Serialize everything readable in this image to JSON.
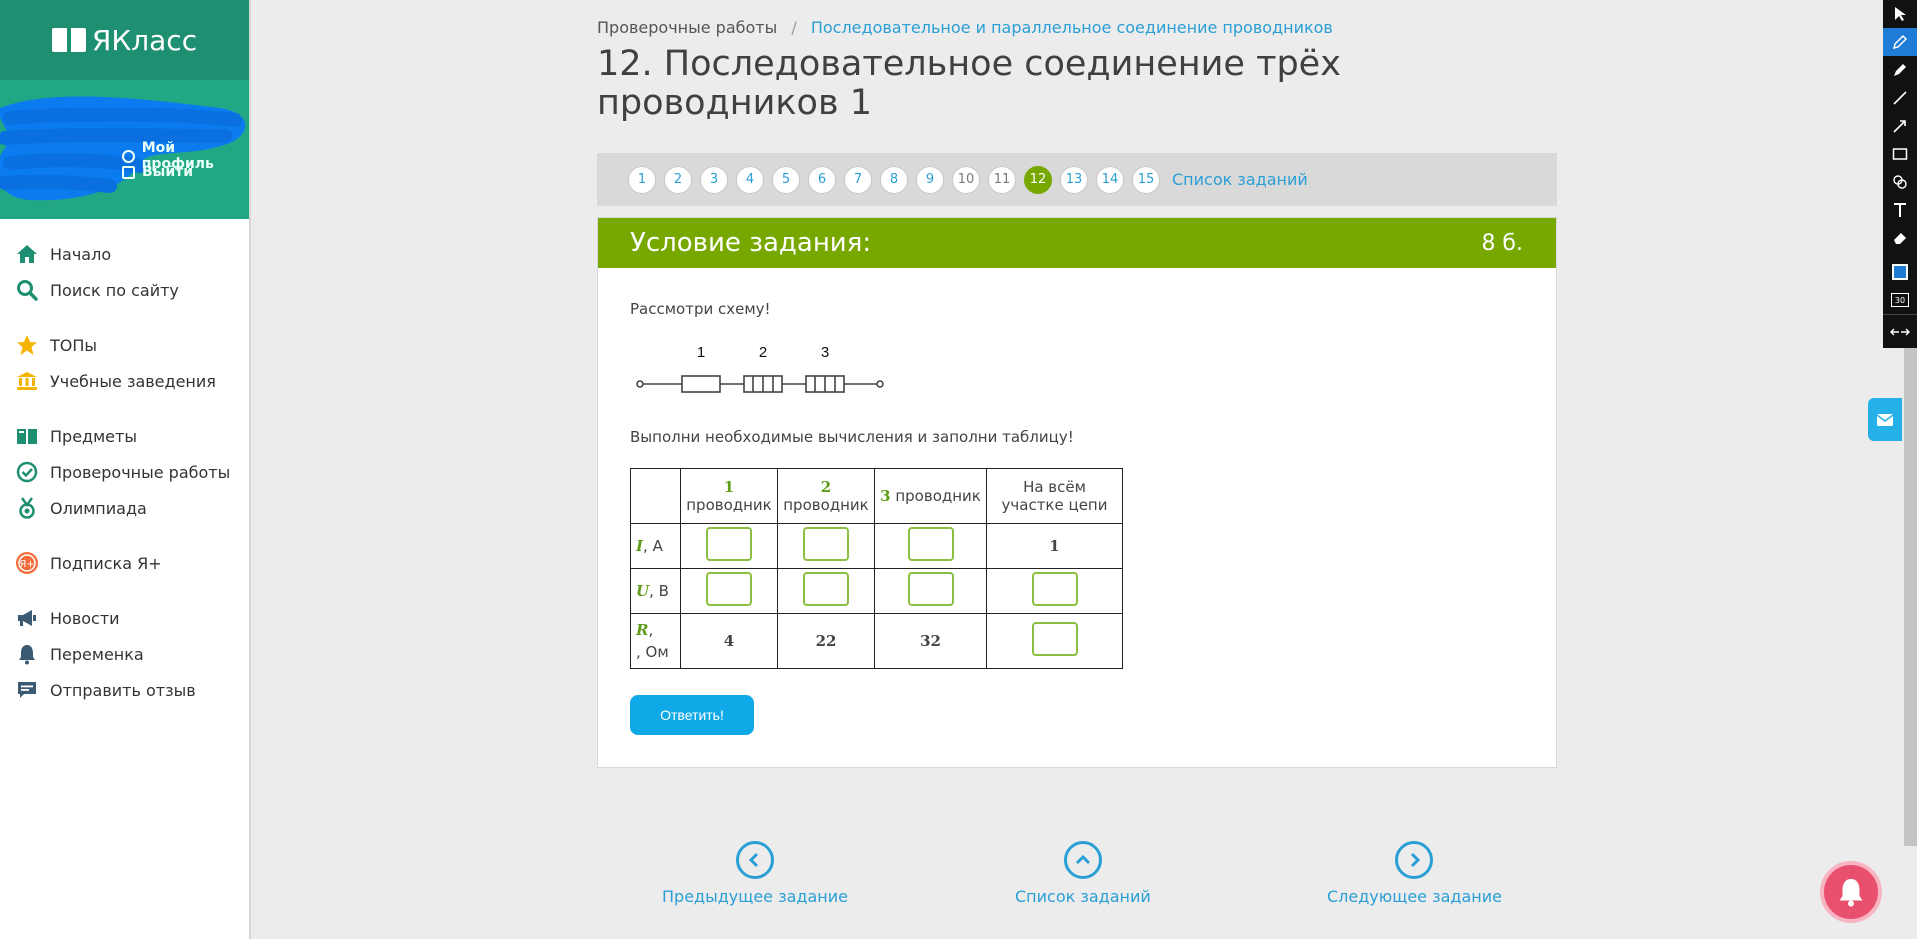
{
  "app": {
    "logo_text": "ЯКласс"
  },
  "user_menu": {
    "profile": "Мой профиль",
    "logout": "Выйти"
  },
  "sidebar": {
    "items": [
      {
        "label": "Начало",
        "icon": "home-icon"
      },
      {
        "label": "Поиск по сайту",
        "icon": "search-icon"
      },
      {
        "label": "ТОПы",
        "icon": "star-icon"
      },
      {
        "label": "Учебные заведения",
        "icon": "institution-icon"
      },
      {
        "label": "Предметы",
        "icon": "books-icon"
      },
      {
        "label": "Проверочные работы",
        "icon": "check-circle-icon"
      },
      {
        "label": "Олимпиада",
        "icon": "medal-icon"
      },
      {
        "label": "Подписка Я+",
        "icon": "subscription-icon"
      },
      {
        "label": "Новости",
        "icon": "megaphone-icon"
      },
      {
        "label": "Переменка",
        "icon": "bell-icon"
      },
      {
        "label": "Отправить отзыв",
        "icon": "feedback-icon"
      }
    ]
  },
  "breadcrumb": {
    "first": "Проверочные работы",
    "separator": "/",
    "second": "Последовательное и параллельное соединение проводников"
  },
  "page_title": "12. Последовательное соединение трёх проводников 1",
  "pager": {
    "pages": [
      "1",
      "2",
      "3",
      "4",
      "5",
      "6",
      "7",
      "8",
      "9",
      "10",
      "11",
      "12",
      "13",
      "14",
      "15"
    ],
    "current": "12",
    "list_link": "Список заданий"
  },
  "task": {
    "header": "Условие задания:",
    "points": "8 б.",
    "text1": "Рассмотри схему!",
    "circuit_labels": [
      "1",
      "2",
      "3"
    ],
    "text2": "Выполни необходимые вычисления и заполни таблицу!",
    "table": {
      "col_headers": [
        {
          "num": "1",
          "word": "проводник"
        },
        {
          "num": "2",
          "word": "проводник"
        },
        {
          "num": "3",
          "word": "проводник"
        },
        {
          "word": "На всём участке цепи"
        }
      ],
      "rows": [
        {
          "sym": "I",
          "unit": ", А",
          "cells": [
            "",
            "",
            "",
            "1"
          ]
        },
        {
          "sym": "U",
          "unit": ", В",
          "cells": [
            "",
            "",
            "",
            ""
          ]
        },
        {
          "sym": "R",
          "unit": ", Ом",
          "cells": [
            "4",
            "22",
            "32",
            ""
          ]
        }
      ]
    },
    "submit_label": "Ответить!"
  },
  "bottom_nav": {
    "prev": "Предыдущее задание",
    "list": "Список заданий",
    "next": "Следующее задание"
  },
  "colors": {
    "brand_green": "#1f8f71",
    "task_green": "#76a800",
    "link_blue": "#2a9fd6",
    "button_blue": "#10a9e8"
  }
}
